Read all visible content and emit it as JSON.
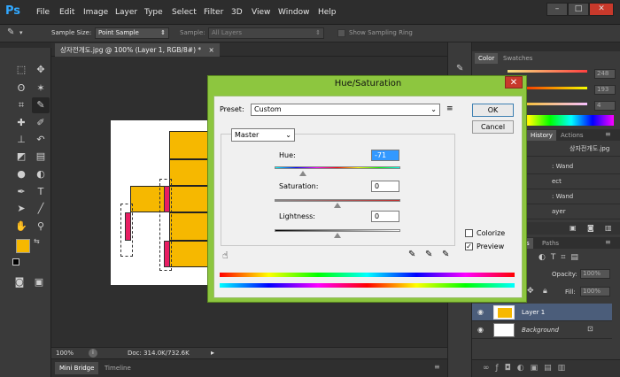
{
  "app": {
    "logo": "Ps"
  },
  "menu": [
    "File",
    "Edit",
    "Image",
    "Layer",
    "Type",
    "Select",
    "Filter",
    "3D",
    "View",
    "Window",
    "Help"
  ],
  "window_controls": {
    "minimize": "–",
    "maximize": "□",
    "close": "✕"
  },
  "options_bar": {
    "sample_size_label": "Sample Size:",
    "sample_size_value": "Point Sample",
    "sample_label": "Sample:",
    "sample_value": "All Layers",
    "show_ring_label": "Show Sampling Ring"
  },
  "document": {
    "tab_title": "상자전개도.jpg @ 100% (Layer 1, RGB/8#) *",
    "tab_close": "×",
    "zoom": "100%",
    "doc_info": "Doc: 314.0K/732.6K"
  },
  "bottom_tabs": [
    "Mini Bridge",
    "Timeline"
  ],
  "color_panel": {
    "tabs": [
      "Color",
      "Swatches"
    ],
    "values": [
      "248",
      "193",
      "4"
    ],
    "slider_colors": [
      "#ff6060",
      "#ffd040",
      "#4f6fff"
    ]
  },
  "history_panel": {
    "tabs": [
      "History",
      "Actions"
    ],
    "snapshot": "상자전개도.jpg",
    "items": [
      ": Wand",
      "ect",
      ": Wand",
      "ayer"
    ]
  },
  "layers_panel": {
    "tabs": [
      "ls",
      "Paths"
    ],
    "opacity_label": "Opacity:",
    "opacity_value": "100%",
    "fill_label": "Fill:",
    "fill_value": "100%",
    "layers": [
      {
        "name": "Layer 1",
        "selected": true
      },
      {
        "name": "Background",
        "selected": false
      }
    ]
  },
  "dialog": {
    "title": "Hue/Saturation",
    "close": "✕",
    "preset_label": "Preset:",
    "preset_value": "Custom",
    "ok": "OK",
    "cancel": "Cancel",
    "channel": "Master",
    "hue_label": "Hue:",
    "hue_value": "-71",
    "saturation_label": "Saturation:",
    "saturation_value": "0",
    "lightness_label": "Lightness:",
    "lightness_value": "0",
    "colorize_label": "Colorize",
    "colorize_checked": false,
    "preview_label": "Preview",
    "preview_checked": true,
    "check_mark": "✓"
  },
  "colors": {
    "accent_dialog_border": "#8dc63f",
    "foreground_swatch": "#f6b800",
    "background_swatch": "#ffffff",
    "layer_selected": "#4b5d7a"
  }
}
